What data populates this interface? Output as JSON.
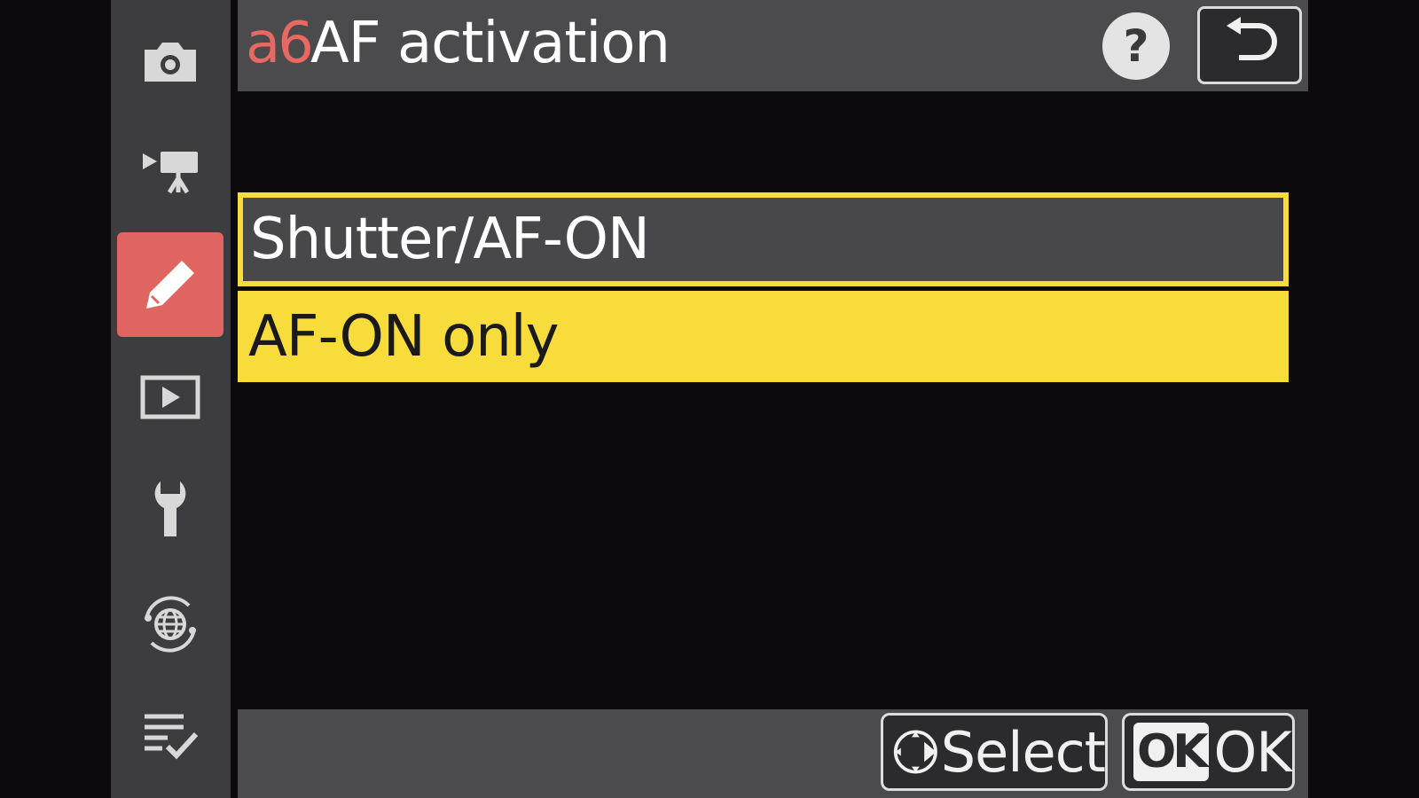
{
  "header": {
    "code": "a6",
    "title": "AF activation",
    "help_icon": "question-mark-icon",
    "help_text": "?",
    "back_icon": "return-arrow-icon"
  },
  "sidebar": {
    "items": [
      {
        "name": "photo-shooting-menu",
        "icon": "camera-icon"
      },
      {
        "name": "video-recording-menu",
        "icon": "movie-camera-icon"
      },
      {
        "name": "custom-settings-menu",
        "icon": "pencil-icon",
        "active": true
      },
      {
        "name": "playback-menu",
        "icon": "play-icon"
      },
      {
        "name": "setup-menu",
        "icon": "wrench-icon"
      },
      {
        "name": "network-menu",
        "icon": "globe-icon"
      },
      {
        "name": "my-menu",
        "icon": "checklist-icon"
      }
    ]
  },
  "options": [
    {
      "label": "Shutter/AF-ON",
      "state": "selected"
    },
    {
      "label": "AF-ON only",
      "state": "highlighted"
    }
  ],
  "footer": {
    "select_label": "Select",
    "ok_box": "OK",
    "ok_label": "OK"
  },
  "colors": {
    "accent_red": "#e06560",
    "highlight_yellow": "#f8dc3b",
    "panel_gray": "#4b4a4c",
    "sidebar_gray": "#3d3c3f"
  }
}
